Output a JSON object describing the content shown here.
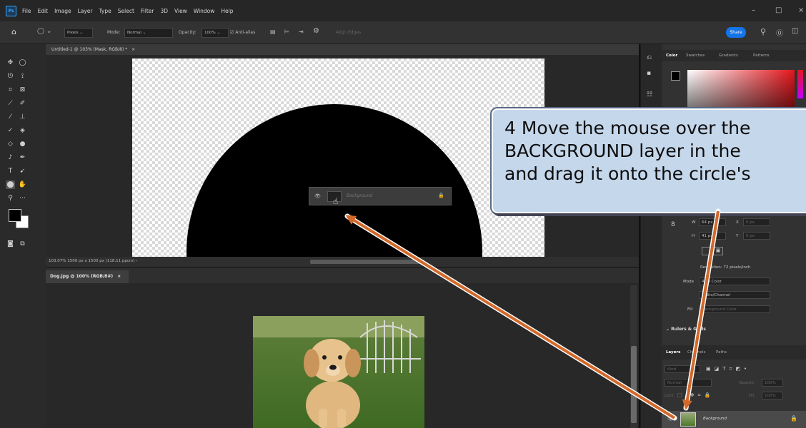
{
  "app": {
    "logo": "Ps"
  },
  "menu": [
    "File",
    "Edit",
    "Image",
    "Layer",
    "Type",
    "Select",
    "Filter",
    "3D",
    "View",
    "Window",
    "Help"
  ],
  "window_controls": {
    "minimize": "–",
    "maximize": "□",
    "close": "×"
  },
  "options_bar": {
    "pixels": "Pixels",
    "mode_label": "Mode:",
    "mode_value": "Normal",
    "opacity_label": "Opacity:",
    "opacity_value": "100%",
    "antialias": "Anti-alias",
    "align_edges": "Align Edges",
    "share": "Share"
  },
  "document1": {
    "tab": "Untitled-1 @ 103% (Mask, RGB/8) *",
    "status": "103.07%   1500 px x 1500 px (118.11 ppcm)   ›"
  },
  "drag_ghost": {
    "layer_name": "Background"
  },
  "document2": {
    "tab": "Dog.jpg @ 100% (RGB/8#)"
  },
  "panel_color": {
    "tabs": [
      "Color",
      "Swatches",
      "Gradients",
      "Patterns"
    ]
  },
  "properties": {
    "w_label": "W",
    "w_value": "64 px",
    "h_label": "H",
    "h_value": "41 px",
    "x_label": "X",
    "x_value": "0 px",
    "y_label": "Y",
    "y_value": "0 px",
    "resolution": "Resolution: 72 pixels/inch",
    "mode_label": "Mode",
    "mode_value": "RGB Color",
    "bits_value": "8 Bits/Channel",
    "fill_label": "Fill",
    "fill_value": "Background Color",
    "rulers_grids": "Rulers & Grids"
  },
  "layers_panel": {
    "tabs": [
      "Layers",
      "Channels",
      "Paths"
    ],
    "kind_placeholder": "Kind",
    "blend_mode": "Normal",
    "opacity_label": "Opacity:",
    "opacity_value": "100%",
    "lock_label": "Lock:",
    "fill_label": "Fill:",
    "fill_value": "100%",
    "layer_name": "Background"
  },
  "callout": {
    "line1": "4  Move the mouse over the",
    "line2": "BACKGROUND layer in the",
    "line3": "and drag it onto the circle's"
  },
  "colors": {
    "accent_blue": "#1473e6",
    "arrow": "#d2692b",
    "callout_bg": "#c5d7eb",
    "ui_dark": "#323232"
  }
}
